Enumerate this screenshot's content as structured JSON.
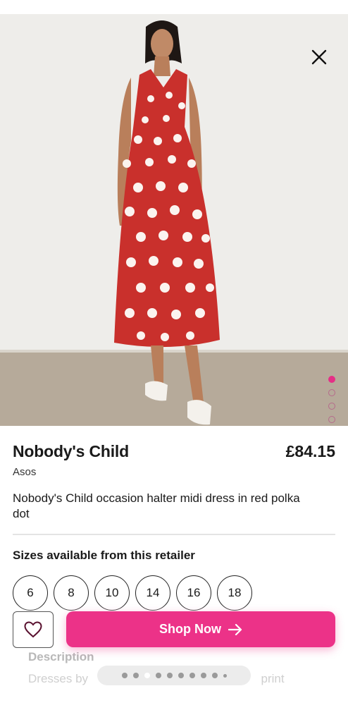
{
  "product": {
    "brand": "Nobody's Child",
    "price": "£84.15",
    "retailer": "Asos",
    "description": "Nobody's Child occasion halter midi dress in red polka dot"
  },
  "sizes": {
    "title": "Sizes available from this retailer",
    "items": [
      "6",
      "8",
      "10",
      "14",
      "16",
      "18"
    ]
  },
  "gallery": {
    "image_count": 4,
    "active_index": 0
  },
  "actions": {
    "shop_label": "Shop Now"
  },
  "details": {
    "heading": "Description",
    "body_visible": "Dresses by",
    "body_tail": "print"
  },
  "colors": {
    "accent": "#ec3288",
    "dress": "#c9302c"
  },
  "icons": [
    "close-icon",
    "heart-icon",
    "arrow-right-icon"
  ]
}
